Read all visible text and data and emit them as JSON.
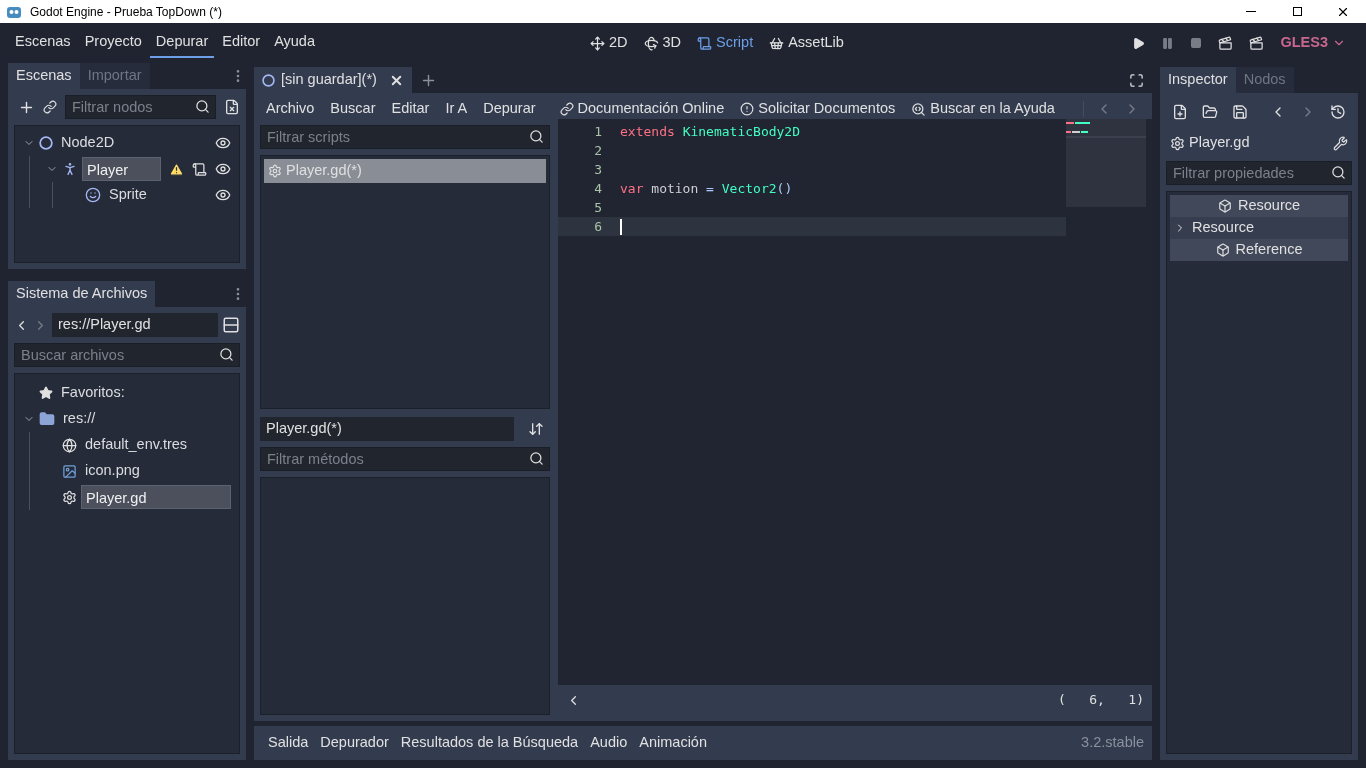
{
  "window": {
    "title": "Godot Engine - Prueba TopDown (*)"
  },
  "menu": [
    {
      "label": "Escenas",
      "selected": false
    },
    {
      "label": "Proyecto",
      "selected": false
    },
    {
      "label": "Depurar",
      "selected": true
    },
    {
      "label": "Editor",
      "selected": false
    },
    {
      "label": "Ayuda",
      "selected": false
    }
  ],
  "workspaces": [
    {
      "label": "2D",
      "kind": "plane",
      "selected": false
    },
    {
      "label": "3D",
      "kind": "space",
      "selected": false
    },
    {
      "label": "Script",
      "kind": "script",
      "selected": true
    },
    {
      "label": "AssetLib",
      "kind": "assetlib",
      "selected": false
    }
  ],
  "renderer": "GLES3",
  "scene_dock": {
    "tabs": [
      {
        "label": "Escenas",
        "selected": true
      },
      {
        "label": "Importar",
        "selected": false
      }
    ],
    "filter_placeholder": "Filtrar nodos",
    "tree": [
      {
        "label": "Node2D",
        "kind": "node2d",
        "selected": false,
        "expanded": true,
        "warning": false,
        "script": false,
        "children": [
          {
            "label": "Player",
            "kind": "kinematic",
            "selected": true,
            "expanded": true,
            "warning": true,
            "script": true,
            "children": [
              {
                "label": "Sprite",
                "kind": "sprite",
                "selected": false,
                "warning": false,
                "script": false
              }
            ]
          }
        ]
      }
    ]
  },
  "filesystem": {
    "tab": "Sistema de Archivos",
    "path": "res://Player.gd",
    "search_placeholder": "Buscar archivos",
    "tree": [
      {
        "label": "Favoritos:",
        "kind": "favorites",
        "selected": false
      },
      {
        "label": "res://",
        "kind": "folder",
        "selected": false,
        "expanded": true,
        "children": [
          {
            "label": "default_env.tres",
            "kind": "environment",
            "selected": false
          },
          {
            "label": "icon.png",
            "kind": "image",
            "selected": false
          },
          {
            "label": "Player.gd",
            "kind": "script",
            "selected": true
          }
        ]
      }
    ]
  },
  "script_tabs": [
    {
      "label": "[sin guardar](*)",
      "selected": true
    }
  ],
  "script_menu": [
    "Archivo",
    "Buscar",
    "Editar",
    "Ir A",
    "Depurar"
  ],
  "help_links": [
    {
      "label": "Documentación Online",
      "kind": "link"
    },
    {
      "label": "Solicitar Documentos",
      "kind": "alert"
    },
    {
      "label": "Buscar en la Ayuda",
      "kind": "doc"
    }
  ],
  "scripts_filter_placeholder": "Filtrar scripts",
  "scripts": [
    {
      "label": "Player.gd(*)",
      "selected": true
    }
  ],
  "methods": {
    "title": "Player.gd(*)",
    "filter_placeholder": "Filtrar métodos"
  },
  "code": [
    {
      "number": "1",
      "current": false,
      "tokens": [
        {
          "text": "extends ",
          "kind": "keyword"
        },
        {
          "text": "KinematicBody2D",
          "kind": "type"
        }
      ]
    },
    {
      "number": "2",
      "current": false
    },
    {
      "number": "3",
      "current": false
    },
    {
      "number": "4",
      "current": false,
      "tokens": [
        {
          "text": "var ",
          "kind": "keyword"
        },
        {
          "text": "motion ",
          "kind": "text"
        },
        {
          "text": "= ",
          "kind": "symbol"
        },
        {
          "text": "Vector2",
          "kind": "type"
        },
        {
          "text": "()",
          "kind": "symbol"
        }
      ]
    },
    {
      "number": "5",
      "current": false
    },
    {
      "number": "6",
      "current": true
    }
  ],
  "cursor_position": "(   6,   1)",
  "bottom_tabs": [
    "Salida",
    "Depurador",
    "Resultados de la Búsqueda",
    "Audio",
    "Animación"
  ],
  "version": "3.2.stable",
  "inspector": {
    "tabs": [
      {
        "label": "Inspector",
        "selected": true
      },
      {
        "label": "Nodos",
        "selected": false
      }
    ],
    "object": "Player.gd",
    "filter_placeholder": "Filtrar propiedades",
    "rows": [
      {
        "label": "Resource",
        "kind": "category"
      },
      {
        "label": "Resource",
        "kind": "section"
      },
      {
        "label": "Reference",
        "kind": "category"
      }
    ]
  }
}
